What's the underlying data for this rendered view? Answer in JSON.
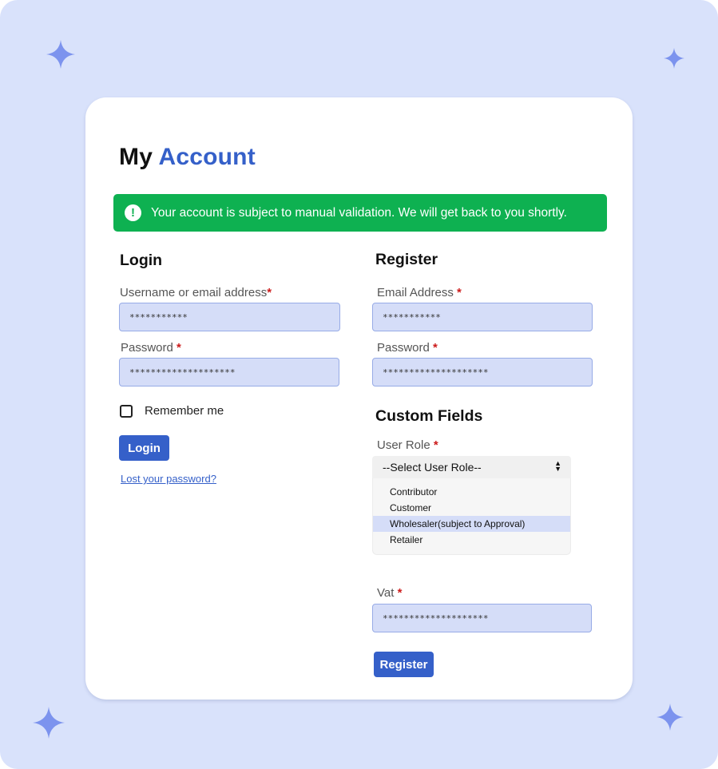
{
  "page": {
    "title_part1": "My",
    "title_part2": "Account",
    "notice": "Your account is subject to manual validation. We will get back to you shortly."
  },
  "login": {
    "heading": "Login",
    "username_label": "Username or email address",
    "username_value": "***********",
    "password_label": "Password",
    "password_value": "********************",
    "remember_label": "Remember me",
    "button_label": "Login",
    "lost_password": "Lost your password?"
  },
  "register": {
    "heading": "Register",
    "email_label": "Email Address",
    "email_value": "***********",
    "password_label": "Password",
    "password_value": "********************",
    "custom_heading": "Custom Fields",
    "role_label": "User Role",
    "role_selected": "--Select User Role--",
    "role_options": [
      "Contributor",
      "Customer",
      "Wholesaler(subject to Approval)",
      "Retailer"
    ],
    "highlighted_option": "Wholesaler(subject to Approval)",
    "vat_label": "Vat",
    "vat_value": "********************",
    "button_label": "Register"
  },
  "required_mark": "*",
  "colors": {
    "background": "#d9e2fb",
    "accent": "#3560c9",
    "notice_bg": "#0eb151",
    "input_bg": "#d5ddf8",
    "required": "#cc1b1b",
    "sparkle": "#7c93ee"
  }
}
